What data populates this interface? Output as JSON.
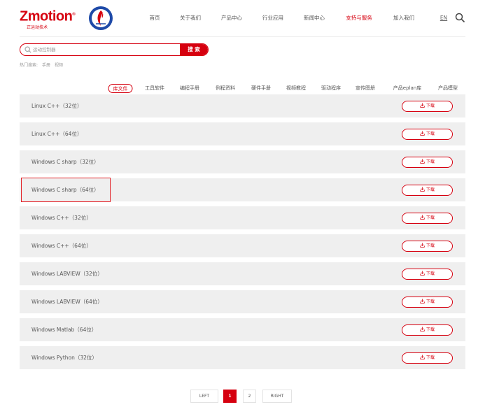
{
  "brand": {
    "name": "Zmotion",
    "trademark": "®",
    "tagline": "正运动技术"
  },
  "nav": {
    "items": [
      {
        "label": "首页",
        "active": false
      },
      {
        "label": "关于我们",
        "active": false
      },
      {
        "label": "产品中心",
        "active": false
      },
      {
        "label": "行业应用",
        "active": false
      },
      {
        "label": "新闻中心",
        "active": false
      },
      {
        "label": "支持与服务",
        "active": true
      },
      {
        "label": "加入我们",
        "active": false
      }
    ],
    "lang": "EN",
    "search_icon": "search-icon"
  },
  "search": {
    "placeholder": "运动控制器",
    "button_label": "搜 索",
    "hot_label": "热门搜索:",
    "hot_items": [
      "手册",
      "视频"
    ]
  },
  "tabs": [
    {
      "label": "库文件",
      "active": true
    },
    {
      "label": "工具软件",
      "active": false
    },
    {
      "label": "编程手册",
      "active": false
    },
    {
      "label": "例程资料",
      "active": false
    },
    {
      "label": "硬件手册",
      "active": false
    },
    {
      "label": "视频教程",
      "active": false
    },
    {
      "label": "驱动程序",
      "active": false
    },
    {
      "label": "宣传图册",
      "active": false
    },
    {
      "label": "产品eplan库",
      "active": false
    },
    {
      "label": "产品模型",
      "active": false
    }
  ],
  "files": [
    {
      "name": "Linux C++（32位）",
      "download": "下载",
      "highlighted": false
    },
    {
      "name": "Linux C++（64位）",
      "download": "下载",
      "highlighted": false
    },
    {
      "name": "Windows C sharp（32位）",
      "download": "下载",
      "highlighted": false
    },
    {
      "name": "Windows C sharp（64位）",
      "download": "下载",
      "highlighted": true
    },
    {
      "name": "Windows C++（32位）",
      "download": "下载",
      "highlighted": false
    },
    {
      "name": "Windows C++（64位）",
      "download": "下载",
      "highlighted": false
    },
    {
      "name": "Windows LABVIEW（32位）",
      "download": "下载",
      "highlighted": false
    },
    {
      "name": "Windows LABVIEW（64位）",
      "download": "下载",
      "highlighted": false
    },
    {
      "name": "Windows Matlab（64位）",
      "download": "下载",
      "highlighted": false
    },
    {
      "name": "Windows Python（32位）",
      "download": "下载",
      "highlighted": false
    }
  ],
  "pagination": {
    "prev_label": "LEFT",
    "pages": [
      "1",
      "2"
    ],
    "current": "1",
    "next_label": "RIGHT"
  },
  "colors": {
    "accent": "#d6000f",
    "row_bg": "#efefef",
    "highlight_box": "#e31e24"
  }
}
